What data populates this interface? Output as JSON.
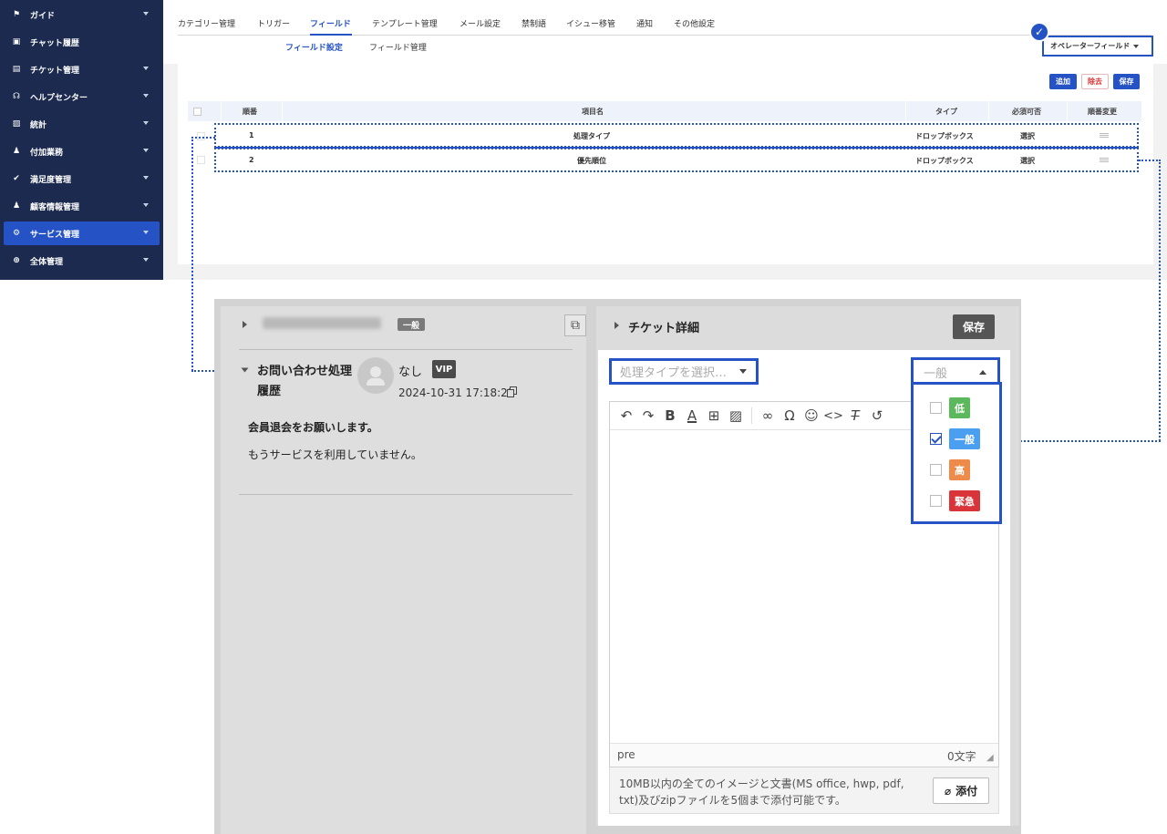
{
  "sidebar": {
    "items": [
      {
        "label": "ガイド",
        "icon": "flag-icon",
        "glyph": "⚑"
      },
      {
        "label": "チャット履歴",
        "icon": "chat-icon",
        "glyph": "💬"
      },
      {
        "label": "チケット管理",
        "icon": "document-icon",
        "glyph": "▤"
      },
      {
        "label": "ヘルプセンター",
        "icon": "headset-icon",
        "glyph": "☊"
      },
      {
        "label": "統計",
        "icon": "chart-icon",
        "glyph": "▨"
      },
      {
        "label": "付加業務",
        "icon": "user-icon",
        "glyph": "♟"
      },
      {
        "label": "満足度管理",
        "icon": "thumbs-up-icon",
        "glyph": "👍"
      },
      {
        "label": "顧客情報管理",
        "icon": "contact-icon",
        "glyph": "♟"
      },
      {
        "label": "サービス管理",
        "icon": "gear-icon",
        "glyph": "⚙"
      },
      {
        "label": "全体管理",
        "icon": "plus-circle-icon",
        "glyph": "⊕"
      }
    ],
    "active_index": 8,
    "colors": {
      "background": "#1b2a4e",
      "active": "#2552c4"
    }
  },
  "tabs": [
    "カテゴリー管理",
    "トリガー",
    "フィールド",
    "テンプレート管理",
    "メール設定",
    "禁制語",
    "イシュー移管",
    "通知",
    "その他設定"
  ],
  "active_tab": "フィールド",
  "subtabs": [
    "フィールド設定",
    "フィールド管理"
  ],
  "active_subtab": "フィールド設定",
  "operator_field_dropdown": "オペレーターフィールド",
  "actions": {
    "add": "追加",
    "remove": "除去",
    "save": "保存"
  },
  "table": {
    "headers": [
      "順番",
      "項目名",
      "タイプ",
      "必須可否",
      "順番変更"
    ],
    "rows": [
      {
        "order": "1",
        "name": "処理タイプ",
        "type": "ドロップボックス",
        "required": "選択"
      },
      {
        "order": "2",
        "name": "優先順位",
        "type": "ドロップボックス",
        "required": "選択"
      }
    ]
  },
  "ticket": {
    "left": {
      "level_tag": "一般",
      "inquiry_title": "お問い合わせ処理履歴",
      "sender_name": "なし",
      "vip_badge": "VIP",
      "timestamp": "2024-10-31 17:18:22",
      "message_line1": "会員退会をお願いします。",
      "message_line2": "もうサービスを利用していません。"
    },
    "right": {
      "title": "チケット詳細",
      "save": "保存",
      "process_type_placeholder": "処理タイプを選択…",
      "priority_selected": "一般",
      "priority_options": [
        {
          "label": "低",
          "color": "#5cb85c",
          "checked": false
        },
        {
          "label": "一般",
          "color": "#4a9ff0",
          "checked": true
        },
        {
          "label": "高",
          "color": "#ee8b4a",
          "checked": false
        },
        {
          "label": "緊急",
          "color": "#d9343a",
          "checked": false
        }
      ],
      "editor_tag": "pre",
      "char_count": "0文字",
      "attach_note_line1": "10MB以内の全てのイメージと文書(MS office, hwp, pdf,",
      "attach_note_line2": "txt)及びzipファイルを5個まで添付可能です。",
      "attach_button": "添付"
    }
  },
  "accent_color": "#2552c4"
}
